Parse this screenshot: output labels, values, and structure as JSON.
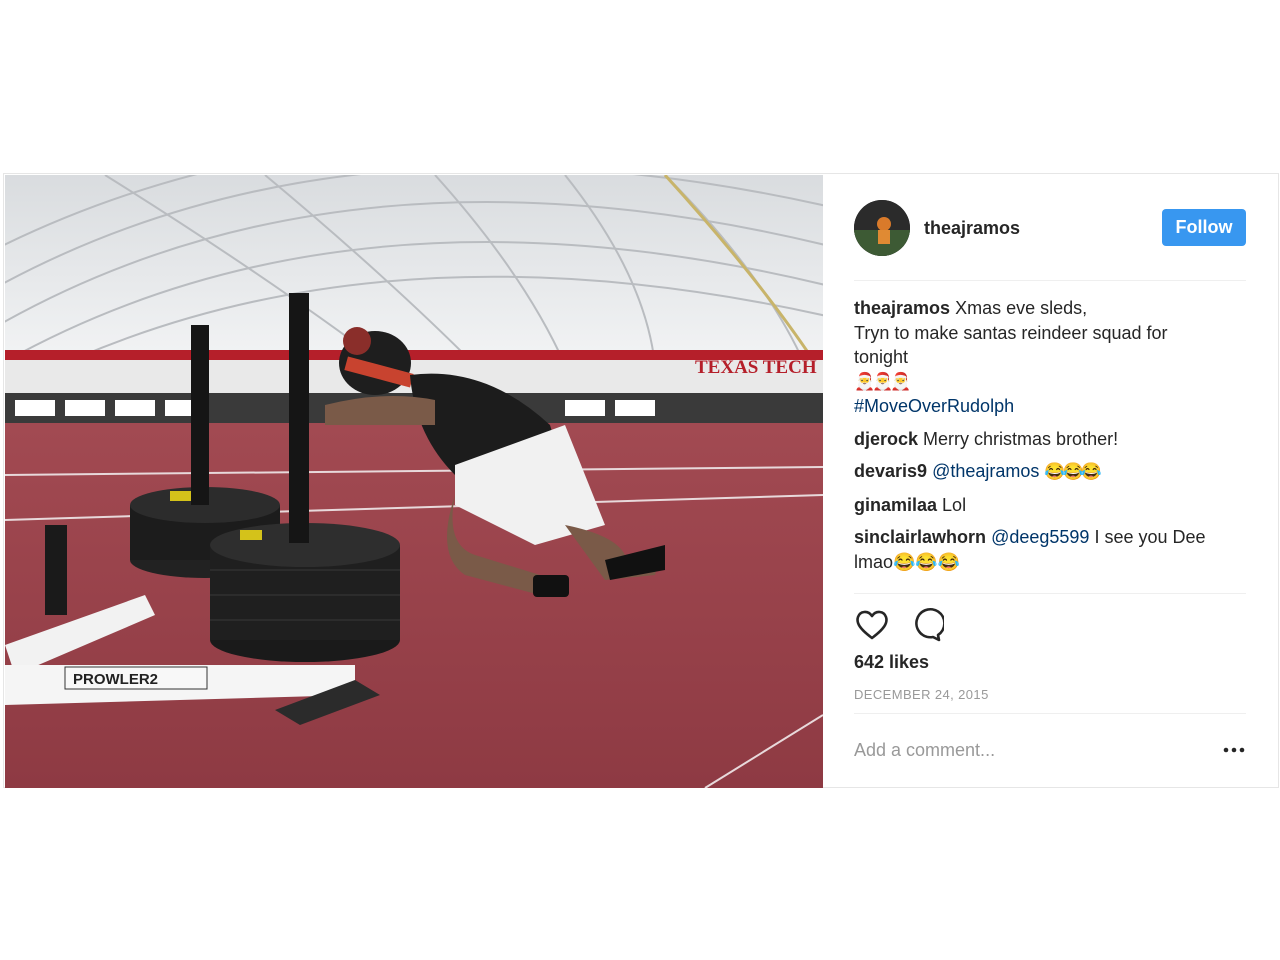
{
  "post": {
    "username": "theajramos",
    "follow_label": "Follow",
    "caption": {
      "user": "theajramos",
      "line1": "Xmas eve sleds,",
      "line2": "Tryn to make santas reindeer squad for",
      "line3": "tonight",
      "emojis": "🎅🎅🎅",
      "hashtag": "#MoveOverRudolph"
    },
    "comments": [
      {
        "user": "djerock",
        "text": "Merry christmas brother!"
      },
      {
        "user": "devaris9",
        "mention": "@theajramos",
        "text": "😂😂😂"
      },
      {
        "user": "ginamilaa",
        "text": "Lol"
      },
      {
        "user": "sinclairlawhorn",
        "mention": "@deeg5599",
        "text": "I see you Dee lmao😂😂😂"
      }
    ],
    "likes": "642 likes",
    "date": "DECEMBER 24, 2015",
    "add_comment_placeholder": "Add a comment...",
    "photo": {
      "banner_text": "TEXAS TECH",
      "sled_label": "PROWLER2"
    },
    "icons": {
      "like": "heart-icon",
      "comment": "comment-icon",
      "more": "more-options-icon"
    },
    "colors": {
      "follow_button": "#3897f0",
      "hashtag": "#003569",
      "track": "#9a3f48"
    }
  }
}
